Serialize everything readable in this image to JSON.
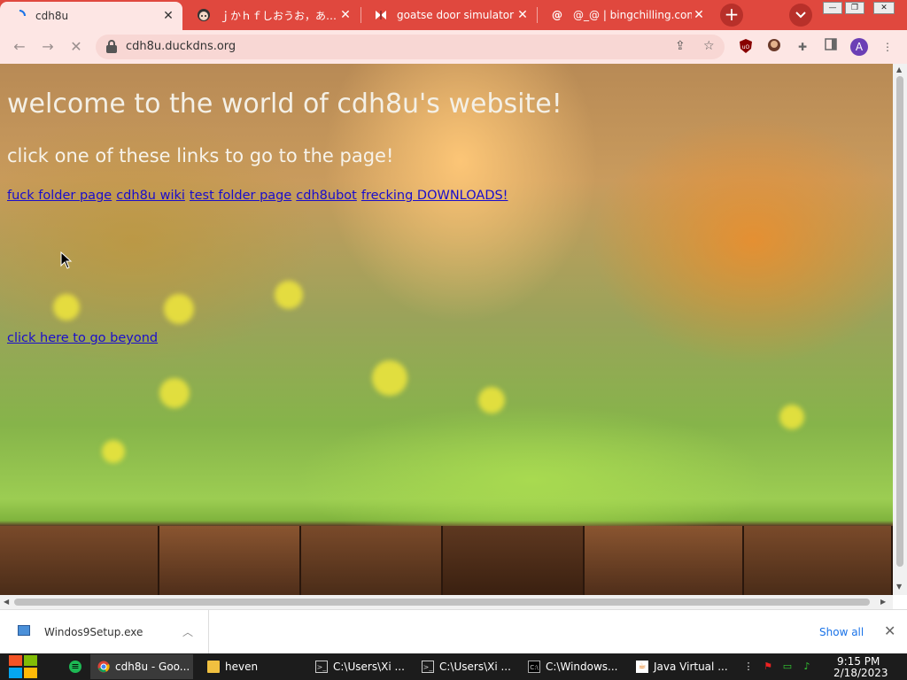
{
  "tabs": [
    {
      "title": "cdh8u",
      "favicon": "loading-spinner",
      "active": true
    },
    {
      "title": "ｊかｈｆしおうお，あ…",
      "favicon": "anime-avatar",
      "active": false
    },
    {
      "title": "goatse door simulator",
      "favicon": "butterfly-icon",
      "active": false
    },
    {
      "title": "@_@ | bingchilling.com",
      "favicon": "at-icon",
      "active": false
    }
  ],
  "new_tab": "+",
  "tab_search": "⌄",
  "address_bar": {
    "url": "cdh8u.duckdns.org"
  },
  "page": {
    "heading": "welcome to the world of cdh8u's website!",
    "subheading": "click one of these links to go to the page!",
    "links": [
      "fuck folder page",
      "cdh8u wiki",
      "test folder page",
      "cdh8ubot",
      "frecking DOWNLOADS!"
    ],
    "beyond_link": "click here to go beyond"
  },
  "download_shelf": {
    "file": "Windos9Setup.exe",
    "show_all": "Show all"
  },
  "taskbar": {
    "items": [
      {
        "label": "cdh8u - Goo...",
        "icon": "chrome-icon",
        "active": true
      },
      {
        "label": "heven",
        "icon": "folder-icon",
        "active": false
      },
      {
        "label": "C:\\Users\\Xi ...",
        "icon": "terminal-icon",
        "active": false
      },
      {
        "label": "C:\\Users\\Xi ...",
        "icon": "terminal-icon",
        "active": false
      },
      {
        "label": "C:\\Windows...",
        "icon": "console-icon",
        "active": false
      },
      {
        "label": "Java Virtual ...",
        "icon": "java-icon",
        "active": false
      }
    ],
    "time": "9:15 PM",
    "date": "2/18/2023"
  }
}
